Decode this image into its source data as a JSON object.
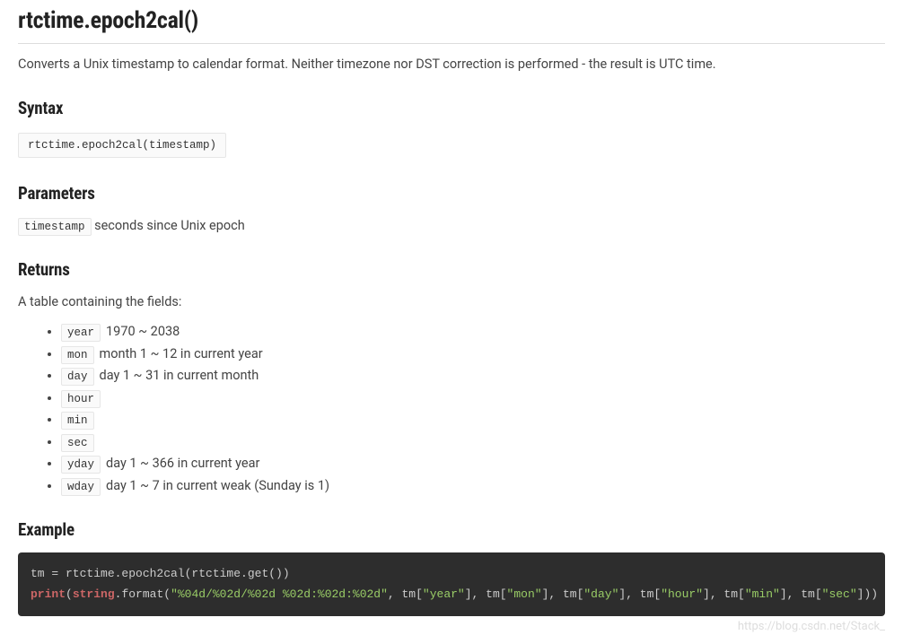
{
  "title": "rtctime.epoch2cal()",
  "intro": "Converts a Unix timestamp to calendar format. Neither timezone nor DST correction is performed - the result is UTC time.",
  "sections": {
    "syntax": {
      "heading": "Syntax",
      "code": "rtctime.epoch2cal(timestamp)"
    },
    "parameters": {
      "heading": "Parameters",
      "param_name": "timestamp",
      "param_desc": "seconds since Unix epoch"
    },
    "returns": {
      "heading": "Returns",
      "intro": "A table containing the fields:",
      "fields": [
        {
          "name": "year",
          "desc": "1970 ~ 2038"
        },
        {
          "name": "mon",
          "desc": "month 1 ~ 12 in current year"
        },
        {
          "name": "day",
          "desc": "day 1 ~ 31 in current month"
        },
        {
          "name": "hour",
          "desc": ""
        },
        {
          "name": "min",
          "desc": ""
        },
        {
          "name": "sec",
          "desc": ""
        },
        {
          "name": "yday",
          "desc": "day 1 ~ 366 in current year"
        },
        {
          "name": "wday",
          "desc": "day 1 ~ 7 in current weak (Sunday is 1)"
        }
      ]
    },
    "example": {
      "heading": "Example",
      "code": {
        "line1_plain": "tm = rtctime.epoch2cal(rtctime.get())",
        "line2_kw": "print",
        "line2_paren1": "(",
        "line2_type": "string",
        "line2_dotformat": ".format(",
        "line2_fmtstr": "\"%04d/%02d/%02d %02d:%02d:%02d\"",
        "line2_sep0": ", tm[",
        "line2_s1": "\"year\"",
        "line2_sep1": "], tm[",
        "line2_s2": "\"mon\"",
        "line2_sep2": "], tm[",
        "line2_s3": "\"day\"",
        "line2_sep3": "], tm[",
        "line2_s4": "\"hour\"",
        "line2_sep4": "], tm[",
        "line2_s5": "\"min\"",
        "line2_sep5": "], tm[",
        "line2_s6": "\"sec\"",
        "line2_tail": "]))"
      }
    }
  },
  "watermark": "https://blog.csdn.net/Stack_"
}
